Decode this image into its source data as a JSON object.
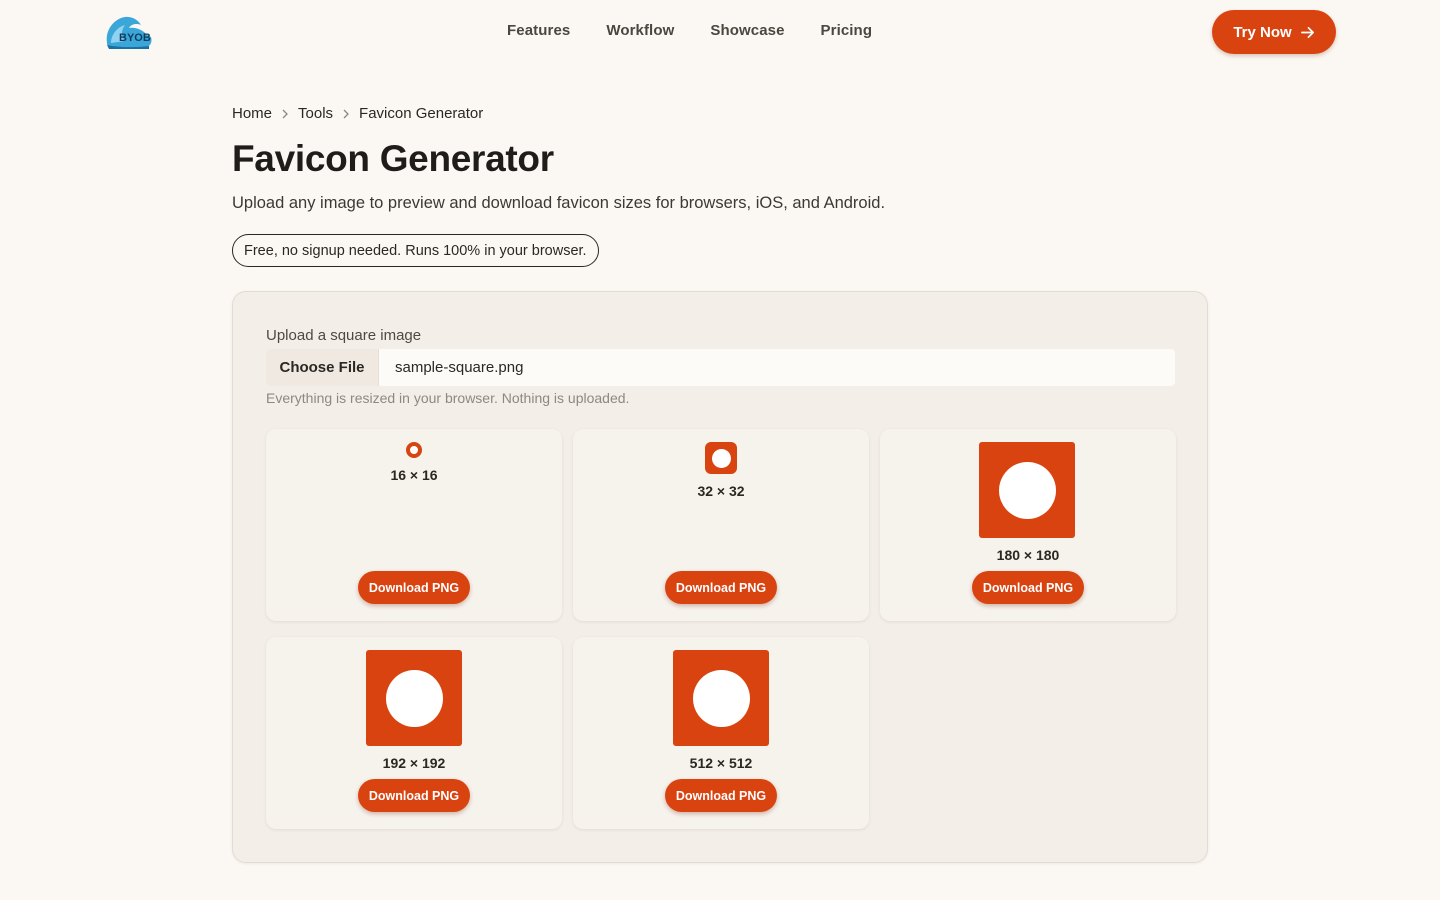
{
  "brand": {
    "logo_text": "BYOB",
    "accent": "#d9430f"
  },
  "nav": {
    "items": [
      "Features",
      "Workflow",
      "Showcase",
      "Pricing"
    ]
  },
  "header": {
    "cta_label": "Try Now"
  },
  "breadcrumb": [
    "Home",
    "Tools",
    "Favicon Generator"
  ],
  "page": {
    "title": "Favicon Generator",
    "subtitle": "Upload any image to preview and download favicon sizes for browsers, iOS, and Android.",
    "badge": "Free, no signup needed. Runs 100% in your browser."
  },
  "upload": {
    "label": "Upload a square image",
    "button": "Choose File",
    "file_name": "sample-square.png",
    "hint": "Everything is resized in your browser. Nothing is uploaded."
  },
  "sizes": [
    {
      "label": "16 × 16",
      "button": "Download PNG"
    },
    {
      "label": "32 × 32",
      "button": "Download PNG"
    },
    {
      "label": "180 × 180",
      "button": "Download PNG"
    },
    {
      "label": "192 × 192",
      "button": "Download PNG"
    },
    {
      "label": "512 × 512",
      "button": "Download PNG"
    }
  ]
}
